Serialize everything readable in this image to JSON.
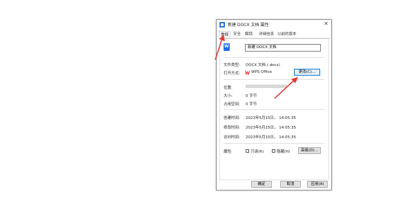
{
  "dialog": {
    "title": "新建 DOCX 文档 属性",
    "close_glyph": "✕"
  },
  "tabs": [
    {
      "label": "常规"
    },
    {
      "label": "安全"
    },
    {
      "label": "解锁"
    },
    {
      "label": "详细信息"
    },
    {
      "label": "以前的版本"
    }
  ],
  "general": {
    "file_name": "新建 DOCX 文档",
    "file_type_label": "文件类型:",
    "file_type_value": "DOCX 文档 (.docx)",
    "open_with_label": "打开方式:",
    "open_with_value": "WPS Office",
    "change_button": "更改(C)...",
    "location_label": "位置:",
    "size_label": "大小:",
    "size_value": "0 字节",
    "disk_size_label": "占用空间:",
    "disk_size_value": "0 字节",
    "created_label": "创建时间:",
    "created_value": "2023年5月15日， 14:05:35",
    "modified_label": "修改时间:",
    "modified_value": "2023年5月15日， 14:05:35",
    "accessed_label": "访问时间:",
    "accessed_value": "2023年5月15日， 14:05:35",
    "attributes_label": "属性:",
    "readonly_label": "只读(R)",
    "hidden_label": "隐藏(H)",
    "advanced_button": "高级(D)..."
  },
  "footer": {
    "ok": "确定",
    "cancel": "取消",
    "apply": "应用(A)"
  },
  "colors": {
    "annotation_arrow": "#e53935",
    "focus_border": "#0078d7",
    "word_icon": "#1f6fe5",
    "wps_icon": "#e53935"
  },
  "icons": {
    "title": "window-icon",
    "file": "word-document-icon",
    "open_with": "wps-icon"
  }
}
